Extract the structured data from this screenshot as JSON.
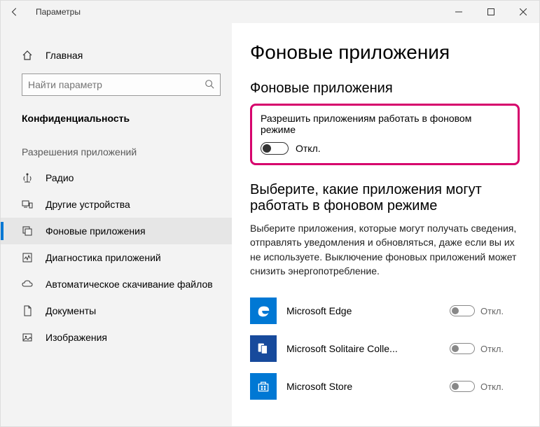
{
  "window": {
    "title": "Параметры"
  },
  "sidebar": {
    "home": "Главная",
    "search_placeholder": "Найти параметр",
    "category": "Конфиденциальность",
    "perm_header": "Разрешения приложений",
    "items": [
      {
        "label": "Радио"
      },
      {
        "label": "Другие устройства"
      },
      {
        "label": "Фоновые приложения"
      },
      {
        "label": "Диагностика приложений"
      },
      {
        "label": "Автоматическое скачивание файлов"
      },
      {
        "label": "Документы"
      },
      {
        "label": "Изображения"
      }
    ]
  },
  "main": {
    "title": "Фоновые приложения",
    "section1": "Фоновые приложения",
    "master_label": "Разрешить приложениям работать в фоновом режиме",
    "master_state": "Откл.",
    "section2": "Выберите, какие приложения могут работать в фоновом режиме",
    "desc": "Выберите приложения, которые могут получать сведения, отправлять уведомления и обновляться, даже если вы их не используете. Выключение фоновых приложений может снизить энергопотребление.",
    "apps": [
      {
        "name": "Microsoft Edge",
        "state": "Откл."
      },
      {
        "name": "Microsoft Solitaire Colle...",
        "state": "Откл."
      },
      {
        "name": "Microsoft Store",
        "state": "Откл."
      }
    ]
  }
}
